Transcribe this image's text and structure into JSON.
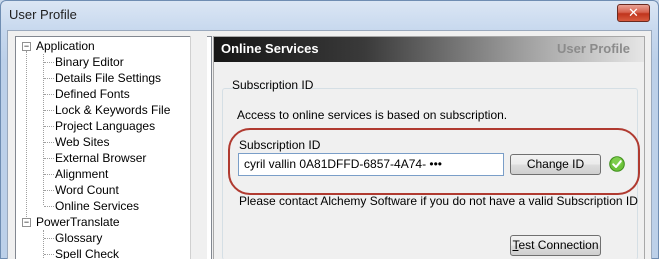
{
  "window": {
    "title": "User Profile",
    "close_glyph": "✕"
  },
  "tree": {
    "groups": [
      {
        "label": "Application",
        "expander": "−",
        "children": [
          "Binary Editor",
          "Details File Settings",
          "Defined Fonts",
          "Lock & Keywords File",
          "Project Languages",
          "Web Sites",
          "External Browser",
          "Alignment",
          "Word Count",
          "Online Services"
        ]
      },
      {
        "label": "PowerTranslate",
        "expander": "−",
        "children": [
          "Glossary",
          "Spell Check"
        ]
      }
    ]
  },
  "content": {
    "header_title": "Online Services",
    "header_right": "User Profile",
    "group_label": "Subscription ID",
    "access_text": "Access to online services is based on subscription.",
    "subscription_label": "Subscription ID",
    "subscription_value": "cyril vallin 0A81DFFD-6857-4A74- •••",
    "change_button": "Change ID",
    "contact_text": "Please contact Alchemy Software if you do not have a valid Subscription ID",
    "test_button_prefix": "T",
    "test_button_rest": "est Connection",
    "status_icon": "green-check-icon"
  },
  "colors": {
    "highlight": "#b03a30",
    "check": "#5cb531",
    "close": "#c0341c"
  }
}
